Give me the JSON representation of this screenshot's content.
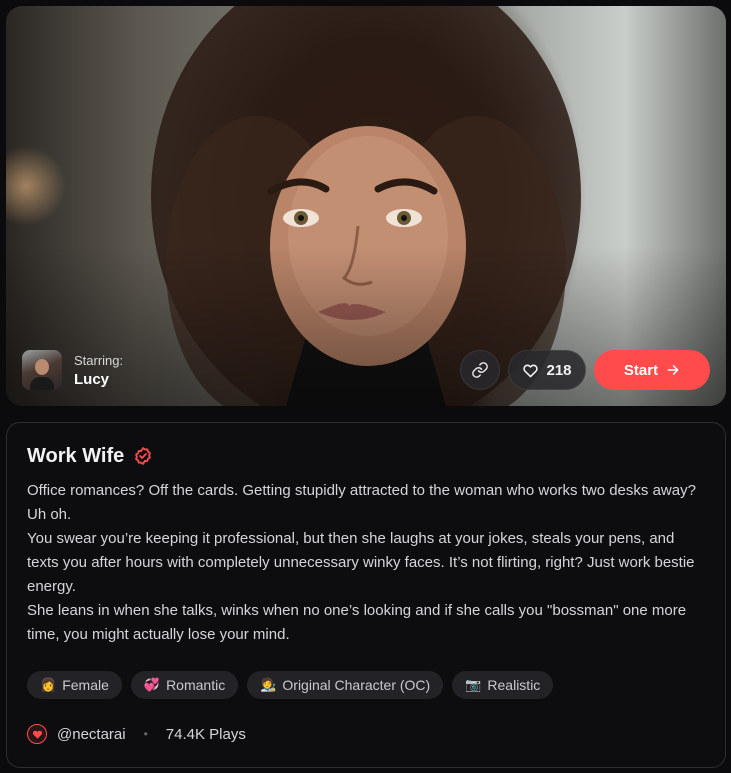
{
  "hero": {
    "starring_label": "Starring:",
    "character_name": "Lucy",
    "like_count": "218",
    "start_label": "Start",
    "accent_color": "#ff4b4b"
  },
  "card": {
    "title": "Work Wife",
    "verified_icon": "check-badge-icon",
    "description": "Office romances? Off the cards. Getting stupidly attracted to the woman who works two desks away? Uh oh.\nYou swear you’re keeping it professional, but then she laughs at your jokes, steals your pens, and texts you after hours with completely unnecessary winky faces. It’s not flirting, right? Just work bestie energy.\nShe leans in when she talks, winks when no one’s looking and if she calls you \"bossman\" one more time, you might actually lose your mind.",
    "tags": [
      {
        "emoji": "👩",
        "label": "Female"
      },
      {
        "emoji": "💞",
        "label": "Romantic"
      },
      {
        "emoji": "🧑‍🎨",
        "label": "Original Character (OC)"
      },
      {
        "emoji": "📷",
        "label": "Realistic"
      }
    ],
    "creator": "@nectarai",
    "plays": "74.4K Plays"
  }
}
